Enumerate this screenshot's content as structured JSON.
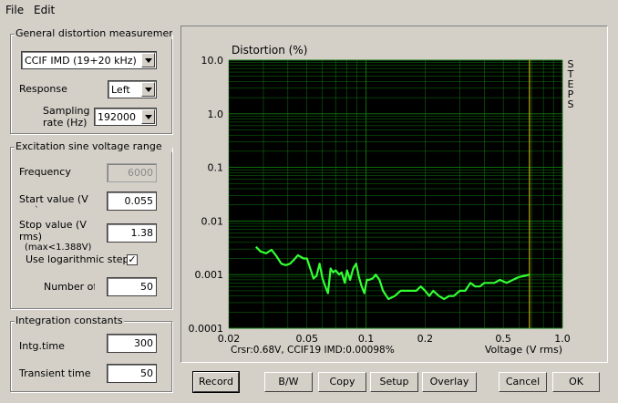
{
  "menu": {
    "file": "File",
    "edit": "Edit"
  },
  "general": {
    "title": "General distortion measuremen",
    "measurement": "CCIF IMD (19+20 kHz)",
    "response_label": "Response",
    "response": "Left",
    "sampling_label_1": "Sampling",
    "sampling_label_2": "rate (Hz)",
    "sampling_rate": "192000"
  },
  "excitation": {
    "title": "Excitation sine voltage range",
    "frequency_label": "Frequency",
    "frequency": "6000",
    "start_label_1": "Start value (V",
    "start_label_2": "`",
    "start": "0.055",
    "stop_label_1": "Stop value (V",
    "stop_label_2": "rms)",
    "stop_label_3": "(max<1.388V)",
    "stop": "1.38",
    "log_label": "Use logarithmic step",
    "log_checked": "✓",
    "number_label": "Number of",
    "number": "50"
  },
  "integration": {
    "title": "Integration constants",
    "time_label": "Intg.time",
    "time": "300",
    "transient_label": "Transient time",
    "transient": "50"
  },
  "buttons": {
    "record": "Record",
    "bw": "B/W",
    "copy": "Copy",
    "setup": "Setup",
    "overlay": "Overlay",
    "cancel": "Cancel",
    "ok": "OK"
  },
  "colors": {
    "plot_bg": "#000000",
    "grid": "#0f7a0f",
    "trace": "#33ff33",
    "cursor": "#c8b400"
  },
  "chart_data": {
    "type": "line",
    "ylabel": "Distortion (%)",
    "xlabel": "Voltage (V rms)",
    "side_label": "STEPS",
    "cursor_text": "Crsr:0.68V, CCIF19 IMD:0.00098%",
    "cursor_x": 0.68,
    "xscale": "log",
    "yscale": "log",
    "xlim": [
      0.02,
      1.0
    ],
    "ylim": [
      0.0001,
      10.0
    ],
    "grid": true,
    "x_ticks": [
      {
        "v": 0.02,
        "label": "0.02"
      },
      {
        "v": 0.05,
        "label": "0.05"
      },
      {
        "v": 0.1,
        "label": "0.1"
      },
      {
        "v": 0.2,
        "label": "0.2"
      },
      {
        "v": 0.5,
        "label": "0.5"
      },
      {
        "v": 1.0,
        "label": "1.0"
      }
    ],
    "y_ticks": [
      {
        "v": 10,
        "label": "10.0"
      },
      {
        "v": 1,
        "label": "1.0"
      },
      {
        "v": 0.1,
        "label": "0.1"
      },
      {
        "v": 0.01,
        "label": "0.01"
      },
      {
        "v": 0.001,
        "label": "0.001"
      },
      {
        "v": 0.0001,
        "label": "0.0001"
      }
    ],
    "series": [
      {
        "x": [
          0.0275,
          0.029,
          0.031,
          0.033,
          0.035,
          0.037,
          0.039,
          0.041,
          0.043,
          0.045,
          0.048,
          0.05,
          0.052,
          0.054,
          0.056,
          0.058,
          0.06,
          0.062,
          0.064,
          0.066,
          0.068,
          0.07,
          0.073,
          0.075,
          0.078,
          0.08,
          0.083,
          0.086,
          0.089,
          0.092,
          0.095,
          0.098,
          0.101,
          0.104,
          0.108,
          0.112,
          0.117,
          0.122,
          0.13,
          0.14,
          0.15,
          0.16,
          0.17,
          0.18,
          0.19,
          0.2,
          0.21,
          0.22,
          0.235,
          0.25,
          0.265,
          0.28,
          0.3,
          0.32,
          0.34,
          0.36,
          0.38,
          0.4,
          0.42,
          0.45,
          0.48,
          0.52,
          0.56,
          0.6,
          0.68
        ],
        "y": [
          0.0033,
          0.0027,
          0.0025,
          0.0029,
          0.0022,
          0.0016,
          0.0015,
          0.0016,
          0.0019,
          0.0023,
          0.002,
          0.002,
          0.0013,
          0.00085,
          0.00095,
          0.0016,
          0.00085,
          0.0006,
          0.00045,
          0.0013,
          0.0011,
          0.0012,
          0.001,
          0.0011,
          0.0007,
          0.0012,
          0.0008,
          0.0013,
          0.0016,
          0.0009,
          0.0006,
          0.00045,
          0.0008,
          0.0008,
          0.00085,
          0.001,
          0.0008,
          0.0005,
          0.00035,
          0.0004,
          0.0005,
          0.0005,
          0.0005,
          0.0005,
          0.0006,
          0.0005,
          0.0004,
          0.0005,
          0.0004,
          0.00035,
          0.0004,
          0.0004,
          0.0005,
          0.0005,
          0.0007,
          0.0006,
          0.0006,
          0.0007,
          0.0007,
          0.0007,
          0.0008,
          0.0007,
          0.0008,
          0.0009,
          0.001
        ]
      }
    ]
  }
}
